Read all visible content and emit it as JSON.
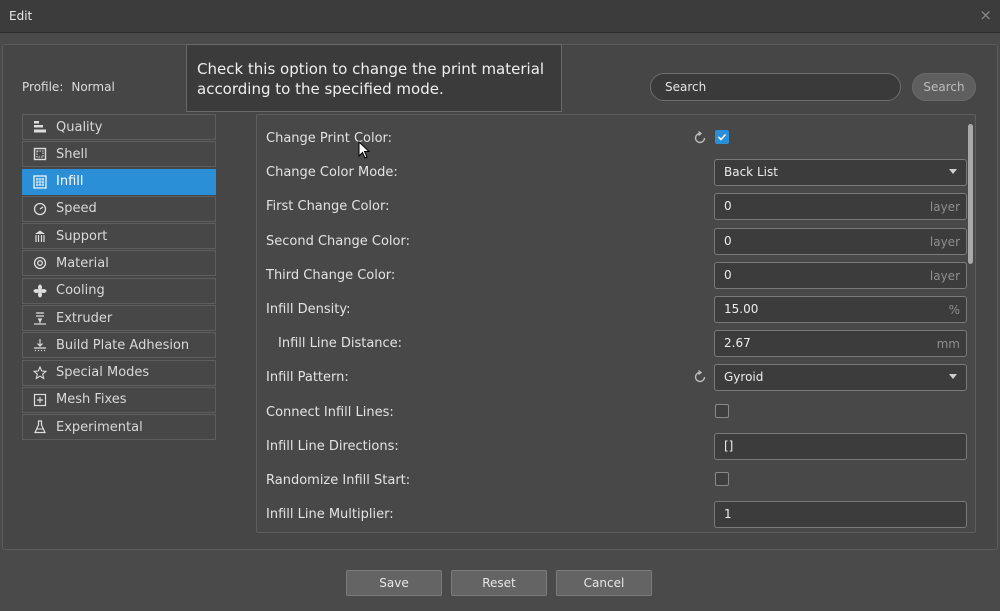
{
  "window": {
    "title": "Edit",
    "close_glyph": "×"
  },
  "profile": {
    "label": "Profile:",
    "value": "Normal"
  },
  "tooltip": {
    "text": "Check this option to change the print material according to the specified mode."
  },
  "search": {
    "placeholder": "Search",
    "button_label": "Search"
  },
  "sidebar": {
    "items": [
      {
        "label": "Quality",
        "icon": "quality-icon",
        "active": false
      },
      {
        "label": "Shell",
        "icon": "shell-icon",
        "active": false
      },
      {
        "label": "Infill",
        "icon": "infill-icon",
        "active": true
      },
      {
        "label": "Speed",
        "icon": "speed-icon",
        "active": false
      },
      {
        "label": "Support",
        "icon": "support-icon",
        "active": false
      },
      {
        "label": "Material",
        "icon": "material-icon",
        "active": false
      },
      {
        "label": "Cooling",
        "icon": "cooling-icon",
        "active": false
      },
      {
        "label": "Extruder",
        "icon": "extruder-icon",
        "active": false
      },
      {
        "label": "Build Plate Adhesion",
        "icon": "build-plate-icon",
        "active": false
      },
      {
        "label": "Special Modes",
        "icon": "special-modes-icon",
        "active": false
      },
      {
        "label": "Mesh Fixes",
        "icon": "mesh-fixes-icon",
        "active": false
      },
      {
        "label": "Experimental",
        "icon": "experimental-icon",
        "active": false
      }
    ]
  },
  "settings": {
    "rows": [
      {
        "label": "Change Print Color:",
        "type": "checkbox",
        "checked": true,
        "reset": true
      },
      {
        "label": "Change Color Mode:",
        "type": "select",
        "value": "Back List"
      },
      {
        "label": "First Change Color:",
        "type": "number",
        "value": "0",
        "unit": "layer"
      },
      {
        "label": "Second Change Color:",
        "type": "number",
        "value": "0",
        "unit": "layer"
      },
      {
        "label": "Third Change Color:",
        "type": "number",
        "value": "0",
        "unit": "layer"
      },
      {
        "label": "Infill Density:",
        "type": "number",
        "value": "15.00",
        "unit": "%"
      },
      {
        "label": "Infill Line Distance:",
        "type": "number",
        "value": "2.67",
        "unit": "mm",
        "indent": true
      },
      {
        "label": "Infill Pattern:",
        "type": "select",
        "value": "Gyroid",
        "reset": true
      },
      {
        "label": "Connect Infill Lines:",
        "type": "checkbox",
        "checked": false
      },
      {
        "label": "Infill Line Directions:",
        "type": "text",
        "value": "[]"
      },
      {
        "label": "Randomize Infill Start:",
        "type": "checkbox",
        "checked": false
      },
      {
        "label": "Infill Line Multiplier:",
        "type": "text",
        "value": "1"
      }
    ]
  },
  "buttons": {
    "save": "Save",
    "reset": "Reset",
    "cancel": "Cancel"
  },
  "colors": {
    "accent": "#2b8fd8",
    "background": "#4a4a4a"
  }
}
